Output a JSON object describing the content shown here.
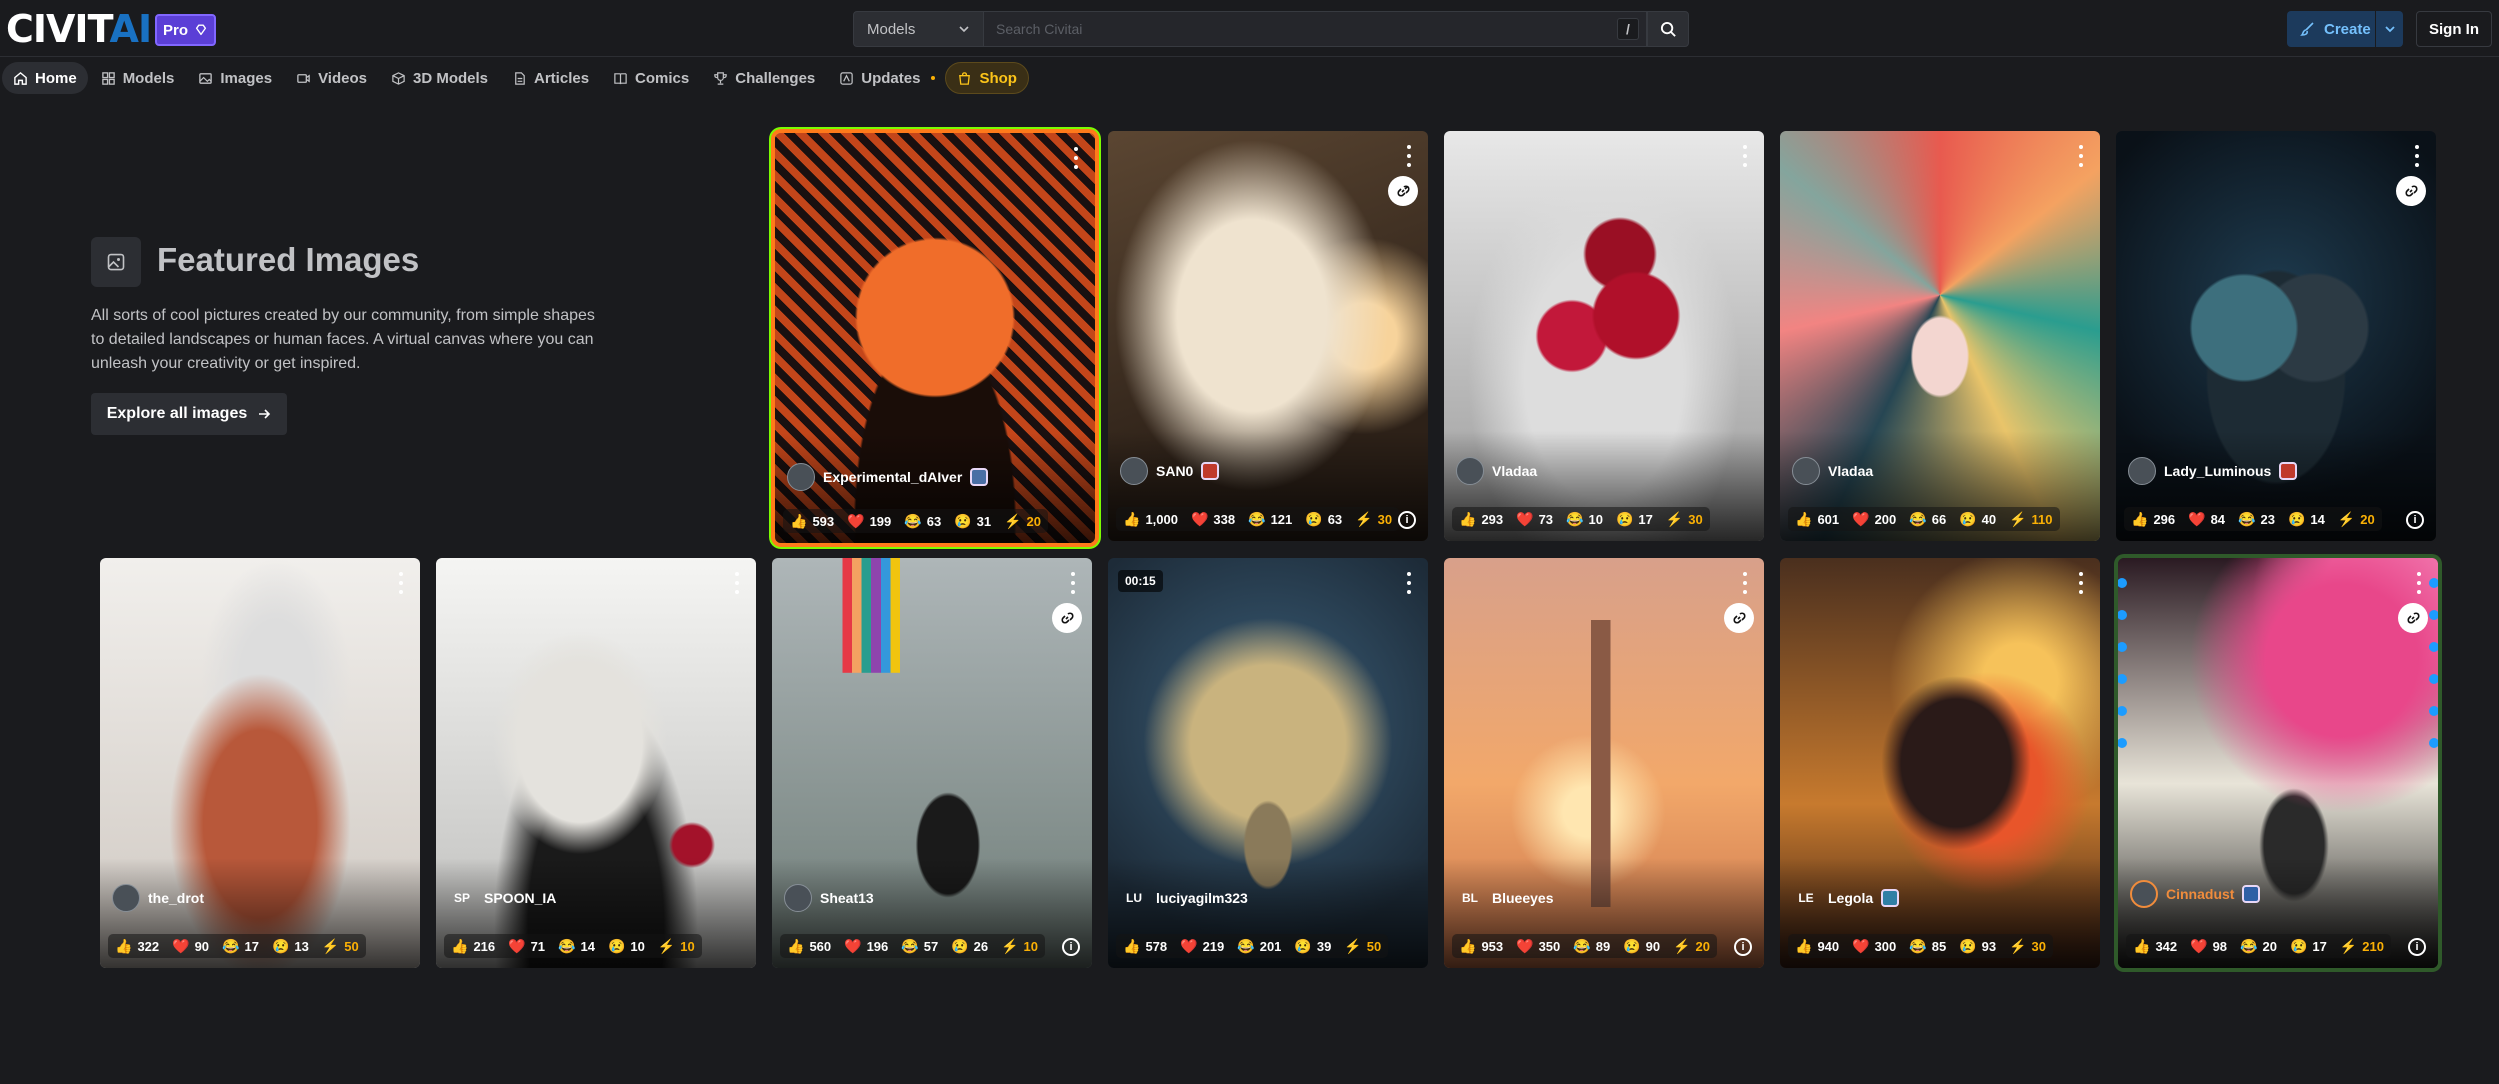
{
  "header": {
    "logo_text_main": "CIVIT",
    "logo_text_accent": "AI",
    "pro_label": "Pro",
    "search_scope": "Models",
    "search_placeholder": "Search Civitai",
    "search_shortcut": "/",
    "create_label": "Create",
    "signin_label": "Sign In"
  },
  "nav": {
    "items": [
      {
        "label": "Home",
        "icon": "home-icon"
      },
      {
        "label": "Models",
        "icon": "grid-icon"
      },
      {
        "label": "Images",
        "icon": "image-icon"
      },
      {
        "label": "Videos",
        "icon": "video-icon"
      },
      {
        "label": "3D Models",
        "icon": "cube-icon"
      },
      {
        "label": "Articles",
        "icon": "article-icon"
      },
      {
        "label": "Comics",
        "icon": "book-icon"
      },
      {
        "label": "Challenges",
        "icon": "trophy-icon"
      },
      {
        "label": "Updates",
        "icon": "updates-icon"
      },
      {
        "label": "Shop",
        "icon": "shopping-bag-icon"
      }
    ]
  },
  "featured": {
    "title": "Featured Images",
    "description": "All sorts of cool pictures created by our community, from simple shapes to detailed landscapes or human faces. A virtual canvas where you can unleash your creativity or get inspired.",
    "explore_label": "Explore all images"
  },
  "cards": [
    {
      "user": "Experimental_dAIver",
      "likes": "593",
      "hearts": "199",
      "laughs": "63",
      "cries": "31",
      "buzz": "20"
    },
    {
      "user": "SAN0",
      "likes": "1,000",
      "hearts": "338",
      "laughs": "121",
      "cries": "63",
      "buzz": "30"
    },
    {
      "user": "Vladaa",
      "likes": "293",
      "hearts": "73",
      "laughs": "10",
      "cries": "17",
      "buzz": "30"
    },
    {
      "user": "Vladaa",
      "likes": "601",
      "hearts": "200",
      "laughs": "66",
      "cries": "40",
      "buzz": "110"
    },
    {
      "user": "Lady_Luminous",
      "likes": "296",
      "hearts": "84",
      "laughs": "23",
      "cries": "14",
      "buzz": "20"
    },
    {
      "user": "the_drot",
      "likes": "322",
      "hearts": "90",
      "laughs": "17",
      "cries": "13",
      "buzz": "50"
    },
    {
      "user": "SPOON_IA",
      "avatar": "SP",
      "likes": "216",
      "hearts": "71",
      "laughs": "14",
      "cries": "10",
      "buzz": "10"
    },
    {
      "user": "Sheat13",
      "likes": "560",
      "hearts": "196",
      "laughs": "57",
      "cries": "26",
      "buzz": "10"
    },
    {
      "user": "luciyagilm323",
      "avatar": "LU",
      "likes": "578",
      "hearts": "219",
      "laughs": "201",
      "cries": "39",
      "buzz": "50",
      "duration": "00:15"
    },
    {
      "user": "Blueeyes",
      "avatar": "BL",
      "likes": "953",
      "hearts": "350",
      "laughs": "89",
      "cries": "90",
      "buzz": "20"
    },
    {
      "user": "Legola",
      "avatar": "LE",
      "likes": "940",
      "hearts": "300",
      "laughs": "85",
      "cries": "93",
      "buzz": "30"
    },
    {
      "user": "Cinnadust",
      "likes": "342",
      "hearts": "98",
      "laughs": "20",
      "cries": "17",
      "buzz": "210"
    }
  ],
  "colors": {
    "background": "#1a1b1e",
    "accent_blue": "#1971c2",
    "pro_purple": "#5b3fd6",
    "buzz_yellow": "#fab005",
    "shop_gold": "#fcc419"
  }
}
